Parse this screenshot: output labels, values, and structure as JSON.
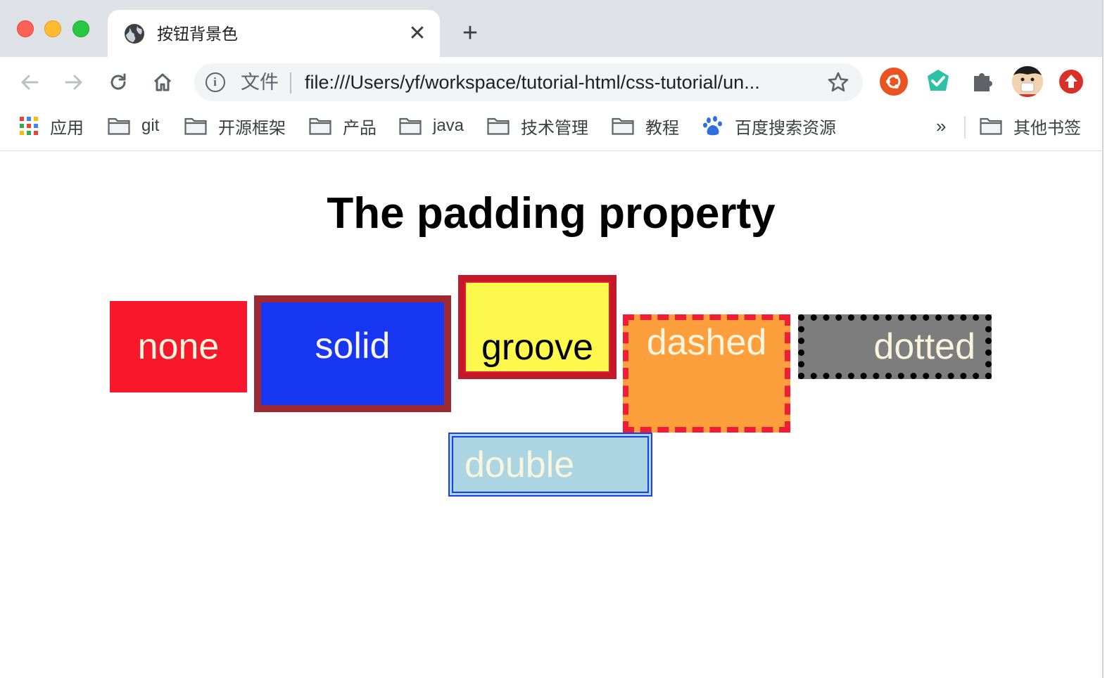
{
  "window": {
    "tab_title": "按钮背景色",
    "new_tab_label": "+",
    "close_tab_label": "✕"
  },
  "toolbar": {
    "scheme_label": "文件",
    "url": "file:///Users/yf/workspace/tutorial-html/css-tutorial/un..."
  },
  "bookmarks": {
    "apps_label": "应用",
    "items": [
      "git",
      "开源框架",
      "产品",
      "java",
      "技术管理",
      "教程"
    ],
    "baidu_label": "百度搜索资源",
    "more_label": "»",
    "other_label": "其他书签"
  },
  "page": {
    "heading": "The padding property",
    "buttons": {
      "none": "none",
      "solid": "solid",
      "groove": "groove",
      "dashed": "dashed",
      "dotted": "dotted",
      "double": "double"
    }
  },
  "colors": {
    "none_bg": "#f9182b",
    "solid_bg": "#1736f2",
    "solid_border": "#9b2a32",
    "groove_bg": "#fdf94c",
    "groove_border": "#c4182b",
    "dashed_bg": "#fd9f3d",
    "dashed_border": "#f21c35",
    "dotted_bg": "#7d7d7d",
    "dotted_border": "#000000",
    "double_bg": "#acd5e3",
    "double_border": "#1d3fe6",
    "button_text": "#f7f5dd"
  },
  "icons": {
    "tab_favicon": "globe-icon",
    "back": "arrow-left-icon",
    "forward": "arrow-right-icon",
    "reload": "reload-icon",
    "home": "home-icon",
    "site_info": "info-icon",
    "bookmark_star": "star-icon",
    "extensions": [
      "ubuntu-icon",
      "check-shield-icon",
      "puzzle-icon",
      "avatar",
      "upload-icon"
    ]
  }
}
